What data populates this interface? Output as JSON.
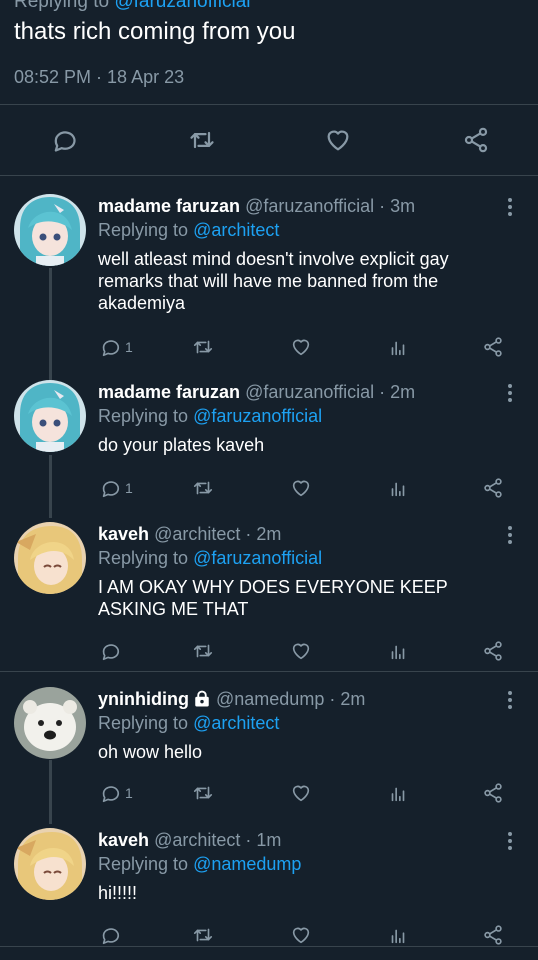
{
  "main_tweet": {
    "replying_cutoff": "Replying to",
    "replying_cutoff_mention": "@faruzanofficial",
    "text": "thats rich coming from you",
    "time": "08:52 PM · 18 Apr 23",
    "actions": [
      "reply",
      "retweet",
      "like",
      "share"
    ]
  },
  "replies": [
    {
      "name": "madame faruzan",
      "handle": "@faruzanofficial",
      "ago": "3m",
      "replying_to": "@architect",
      "text": "well atleast mind doesn't involve explicit gay remarks that will have me banned from the akademiya",
      "reply_count": "1",
      "avatar": "faruzan"
    },
    {
      "name": "madame faruzan",
      "handle": "@faruzanofficial",
      "ago": "2m",
      "replying_to": "@faruzanofficial",
      "text": "do your plates kaveh",
      "reply_count": "1",
      "avatar": "faruzan"
    },
    {
      "name": "kaveh",
      "handle": "@architect",
      "ago": "2m",
      "replying_to": "@faruzanofficial",
      "text": "I AM OKAY WHY DOES EVERYONE KEEP ASKING ME THAT",
      "reply_count": "",
      "avatar": "kaveh"
    },
    {
      "name": "yninhiding",
      "handle": "@namedump",
      "ago": "2m",
      "replying_to": "@architect",
      "text": "oh wow hello",
      "reply_count": "1",
      "avatar": "polar-bear",
      "locked": true
    },
    {
      "name": "kaveh",
      "handle": "@architect",
      "ago": "1m",
      "replying_to": "@namedump",
      "text": "hi!!!!!",
      "reply_count": "",
      "avatar": "kaveh"
    }
  ],
  "labels": {
    "replying_prefix": "Replying to",
    "dot": "·"
  },
  "colors": {
    "background": "#15202b",
    "muted": "#8899a6",
    "accent": "#1da1f2",
    "divider": "#38444d"
  }
}
